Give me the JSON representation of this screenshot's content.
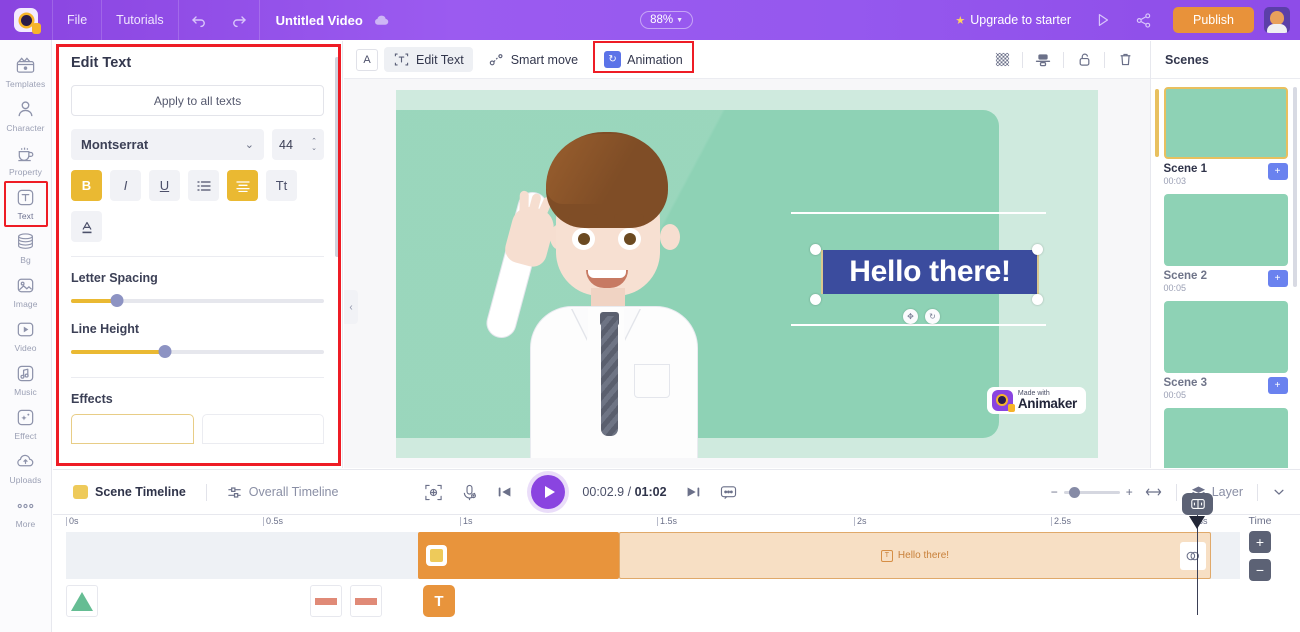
{
  "topbar": {
    "logo": "animaker-logo",
    "menu": [
      "File",
      "Tutorials"
    ],
    "undo_icon": "undo-icon",
    "redo_icon": "redo-icon",
    "project_title": "Untitled Video",
    "cloud_icon": "cloud-saved-icon",
    "zoom": "88%",
    "upgrade": "Upgrade to starter",
    "preview_icon": "preview-icon",
    "share_icon": "share-icon",
    "publish": "Publish",
    "avatar": "user-avatar"
  },
  "rail": {
    "items": [
      {
        "label": "Templates",
        "icon": "templates-icon",
        "active": false
      },
      {
        "label": "Character",
        "icon": "character-icon",
        "active": false
      },
      {
        "label": "Property",
        "icon": "property-icon",
        "active": false
      },
      {
        "label": "Text",
        "icon": "text-icon",
        "active": true
      },
      {
        "label": "Bg",
        "icon": "background-icon",
        "active": false
      },
      {
        "label": "Image",
        "icon": "image-icon",
        "active": false
      },
      {
        "label": "Video",
        "icon": "video-icon",
        "active": false
      },
      {
        "label": "Music",
        "icon": "music-icon",
        "active": false
      },
      {
        "label": "Effect",
        "icon": "effect-icon",
        "active": false
      },
      {
        "label": "Uploads",
        "icon": "uploads-icon",
        "active": false
      },
      {
        "label": "More",
        "icon": "more-icon",
        "active": false
      }
    ]
  },
  "panel": {
    "title": "Edit Text",
    "apply_all": "Apply to all texts",
    "font_family": "Montserrat",
    "font_size": "44",
    "format_buttons": [
      {
        "name": "bold-button",
        "glyph": "B",
        "active": true
      },
      {
        "name": "italic-button",
        "glyph": "I",
        "active": false
      },
      {
        "name": "underline-button",
        "glyph": "U",
        "active": false
      },
      {
        "name": "list-button",
        "glyph": "list-icon",
        "active": false
      },
      {
        "name": "align-button",
        "glyph": "align-center-icon",
        "active": true
      },
      {
        "name": "text-case-button",
        "glyph": "Tt",
        "active": false
      },
      {
        "name": "font-color-button",
        "glyph": "A",
        "active": false
      }
    ],
    "letter_spacing_label": "Letter Spacing",
    "letter_spacing_value": 18,
    "line_height_label": "Line Height",
    "line_height_value": 37,
    "effects_label": "Effects"
  },
  "stage_toolbar": {
    "font_icon": "A",
    "edit_text": "Edit Text",
    "smart_move": "Smart move",
    "animation": "Animation",
    "right_icons": [
      "transparency-icon",
      "align-icon",
      "unlock-icon",
      "delete-icon"
    ]
  },
  "canvas": {
    "text_object": "Hello there!",
    "watermark_small": "Made with",
    "watermark_big": "Animaker",
    "bg_color": "#cfeade",
    "shape_color": "#8ed2b5",
    "text_highlight_color": "#3b4c9e"
  },
  "scenes": {
    "title": "Scenes",
    "items": [
      {
        "name": "Scene 1",
        "duration": "00:03",
        "current": true
      },
      {
        "name": "Scene 2",
        "duration": "00:05",
        "current": false
      },
      {
        "name": "Scene 3",
        "duration": "00:05",
        "current": false
      },
      {
        "name": "",
        "duration": "",
        "current": false
      }
    ],
    "add_label": "+"
  },
  "player": {
    "scene_timeline": "Scene Timeline",
    "overall_timeline": "Overall Timeline",
    "fit_icon": "fit-to-screen-icon",
    "mic_icon": "record-voice-icon",
    "prev_icon": "previous-scene-icon",
    "play_icon": "play-icon",
    "current_time": "00:02.9",
    "separator": "/",
    "total_time": "01:02",
    "next_icon": "next-scene-icon",
    "subtitle_icon": "subtitle-icon",
    "zoom_minus": "−",
    "zoom_plus": "+",
    "fit_width_icon": "fit-width-icon",
    "layer": "Layer",
    "chevron": "chevron-down-icon"
  },
  "timeline": {
    "ticks": [
      "0s",
      "0.5s",
      "1s",
      "1.5s",
      "2s",
      "2.5s",
      "3s"
    ],
    "clip_label": "Hello there!",
    "time_label": "Time",
    "plus": "+",
    "minus": "−",
    "object_t": "T"
  }
}
